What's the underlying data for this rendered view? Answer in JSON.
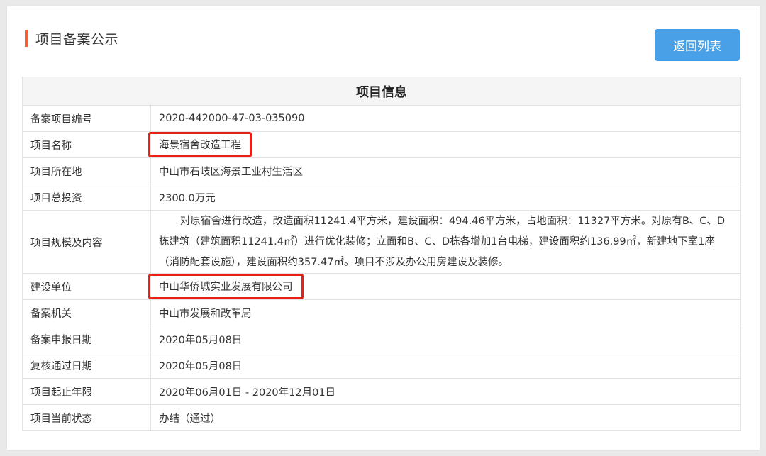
{
  "header": {
    "title": "项目备案公示",
    "back_button_label": "返回列表"
  },
  "table": {
    "heading": "项目信息",
    "rows": [
      {
        "label": "备案项目编号",
        "value": "2020-442000-47-03-035090"
      },
      {
        "label": "项目名称",
        "value": "海景宿舍改造工程",
        "highlighted": true
      },
      {
        "label": "项目所在地",
        "value": "中山市石岐区海景工业村生活区"
      },
      {
        "label": "项目总投资",
        "value": "2300.0万元"
      },
      {
        "label": "项目规模及内容",
        "value": "对原宿舍进行改造，改造面积11241.4平方米，建设面积：494.46平方米，占地面积：11327平方米。对原有B、C、D栋建筑（建筑面积11241.4㎡）进行优化装修；立面和B、C、D栋各增加1台电梯，建设面积约136.99㎡，新建地下室1座（消防配套设施），建设面积约357.47㎡。项目不涉及办公用房建设及装修。"
      },
      {
        "label": "建设单位",
        "value": "中山华侨城实业发展有限公司",
        "highlighted": true
      },
      {
        "label": "备案机关",
        "value": "中山市发展和改革局"
      },
      {
        "label": "备案申报日期",
        "value": "2020年05月08日"
      },
      {
        "label": "复核通过日期",
        "value": "2020年05月08日"
      },
      {
        "label": "项目起止年限",
        "value": "2020年06月01日 - 2020年12月01日"
      },
      {
        "label": "项目当前状态",
        "value": "办结（通过）"
      }
    ]
  },
  "colors": {
    "accent": "#f0643c",
    "button": "#4aa0e6",
    "highlight_box": "#e8201a"
  }
}
